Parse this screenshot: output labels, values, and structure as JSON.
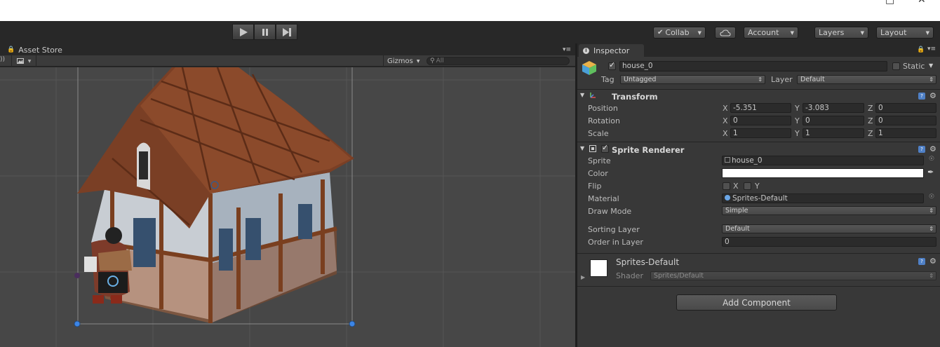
{
  "toolbar": {
    "play_icon": "play-icon",
    "pause_icon": "pause-icon",
    "step_icon": "step-icon",
    "collab": "Collab",
    "cloud_icon": "cloud-icon",
    "account": "Account",
    "layers": "Layers",
    "layout": "Layout"
  },
  "scene": {
    "tab_label": "Asset Store",
    "gizmos": "Gizmos",
    "search_placeholder": "All"
  },
  "inspector": {
    "tab_label": "Inspector",
    "object_name": "house_0",
    "static_label": "Static",
    "tag_label": "Tag",
    "tag_value": "Untagged",
    "layer_label": "Layer",
    "layer_value": "Default",
    "transform": {
      "title": "Transform",
      "position_label": "Position",
      "rotation_label": "Rotation",
      "scale_label": "Scale",
      "axis_x": "X",
      "axis_y": "Y",
      "axis_z": "Z",
      "position": {
        "x": "-5.351",
        "y": "-3.083",
        "z": "0"
      },
      "rotation": {
        "x": "0",
        "y": "0",
        "z": "0"
      },
      "scale": {
        "x": "1",
        "y": "1",
        "z": "1"
      }
    },
    "sprite_renderer": {
      "title": "Sprite Renderer",
      "sprite_label": "Sprite",
      "sprite_value": "house_0",
      "color_label": "Color",
      "color_value": "#ffffff",
      "flip_label": "Flip",
      "flip_x": "X",
      "flip_y": "Y",
      "material_label": "Material",
      "material_value": "Sprites-Default",
      "draw_mode_label": "Draw Mode",
      "draw_mode_value": "Simple",
      "sorting_layer_label": "Sorting Layer",
      "sorting_layer_value": "Default",
      "order_label": "Order in Layer",
      "order_value": "0"
    },
    "material": {
      "name": "Sprites-Default",
      "shader_label": "Shader",
      "shader_value": "Sprites/Default"
    },
    "add_component": "Add Component"
  },
  "colors": {
    "panel_bg": "#383838",
    "viewport_bg": "#474747",
    "accent_blue": "#4f80c6"
  }
}
